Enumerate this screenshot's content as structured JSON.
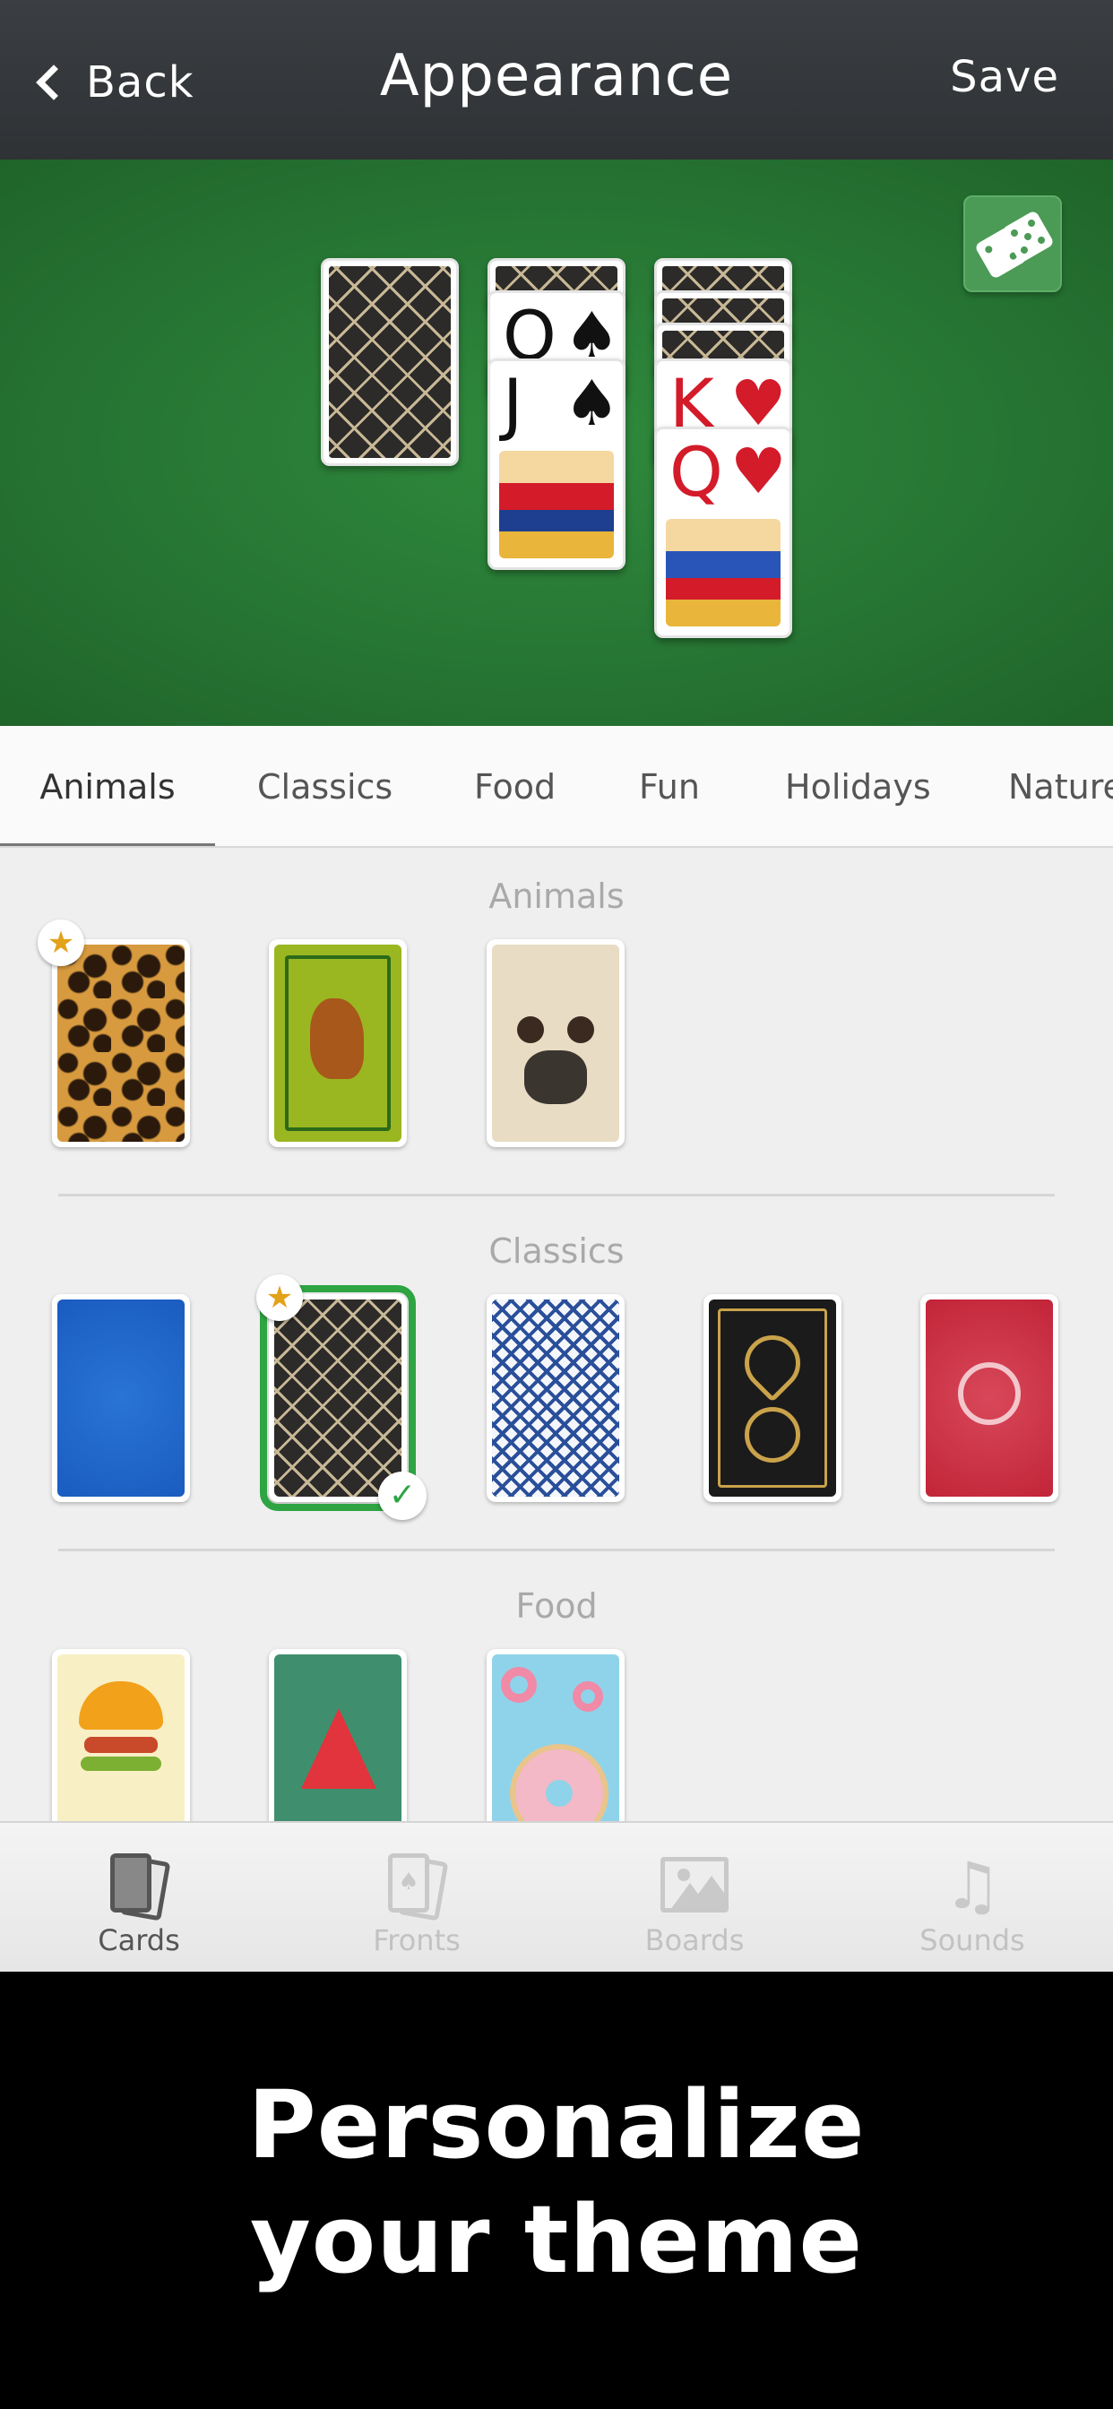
{
  "header": {
    "back_label": "Back",
    "title": "Appearance",
    "save_label": "Save"
  },
  "preview": {
    "random_button_icon": "dice-icon",
    "piles": [
      {
        "cards": [
          "back"
        ]
      },
      {
        "cards": [
          "back",
          "Q♠",
          "J♠"
        ]
      },
      {
        "cards": [
          "back",
          "back",
          "back",
          "K♥",
          "Q♥"
        ]
      }
    ],
    "card_labels": {
      "q": "Q",
      "j": "J",
      "k": "K",
      "spade": "♠",
      "heart": "♥"
    }
  },
  "tabs": [
    {
      "label": "Animals",
      "active": true
    },
    {
      "label": "Classics",
      "active": false
    },
    {
      "label": "Food",
      "active": false
    },
    {
      "label": "Fun",
      "active": false
    },
    {
      "label": "Holidays",
      "active": false
    },
    {
      "label": "Nature",
      "active": false
    }
  ],
  "sections": [
    {
      "title": "Animals",
      "items": [
        "leopard",
        "kangaroo",
        "pug"
      ]
    },
    {
      "title": "Classics",
      "items": [
        "blue-damask",
        "gold-geometric",
        "blue-lattice",
        "black-gold",
        "red-floral"
      ]
    },
    {
      "title": "Food",
      "items": [
        "burger",
        "watermelon",
        "donut"
      ]
    }
  ],
  "selected_card": "gold-geometric",
  "starred_cards": [
    "leopard",
    "gold-geometric"
  ],
  "bottom_nav": [
    {
      "label": "Cards",
      "icon": "cards-icon",
      "active": true
    },
    {
      "label": "Fronts",
      "icon": "card-fronts-icon",
      "active": false
    },
    {
      "label": "Boards",
      "icon": "image-icon",
      "active": false
    },
    {
      "label": "Sounds",
      "icon": "music-note-icon",
      "active": false
    }
  ],
  "promo": {
    "line1": "Personalize",
    "line2": "your theme"
  },
  "colors": {
    "header_bg": "#35383b",
    "board_green": "#2a7d36",
    "selected_green": "#2ea443",
    "star_gold": "#e2a21a"
  }
}
